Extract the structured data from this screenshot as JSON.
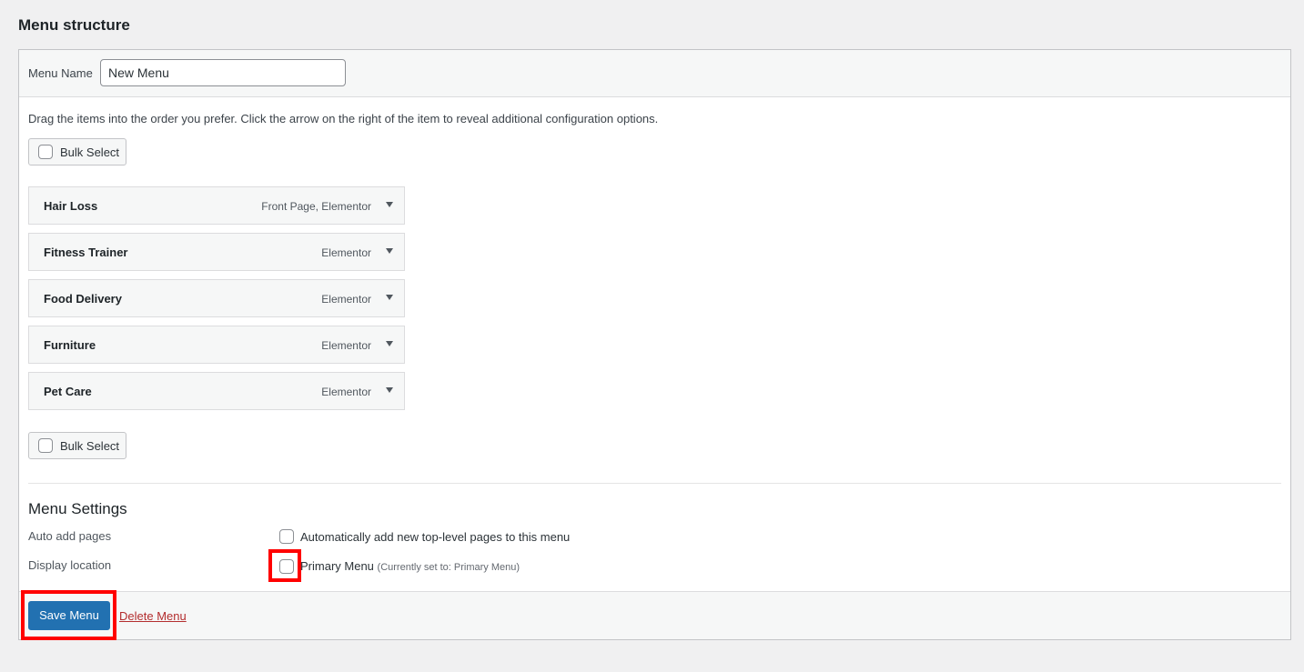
{
  "page": {
    "heading": "Menu structure"
  },
  "menu_name": {
    "label": "Menu Name",
    "value": "New Menu"
  },
  "instructions": "Drag the items into the order you prefer. Click the arrow on the right of the item to reveal additional configuration options.",
  "bulk_select": {
    "label": "Bulk Select"
  },
  "menu_items": [
    {
      "title": "Hair Loss",
      "type": "Front Page, Elementor"
    },
    {
      "title": "Fitness Trainer",
      "type": "Elementor"
    },
    {
      "title": "Food Delivery",
      "type": "Elementor"
    },
    {
      "title": "Furniture",
      "type": "Elementor"
    },
    {
      "title": "Pet Care",
      "type": "Elementor"
    }
  ],
  "settings": {
    "title": "Menu Settings",
    "auto_add": {
      "label": "Auto add pages",
      "option": "Automatically add new top-level pages to this menu"
    },
    "display_location": {
      "label": "Display location",
      "option": "Primary Menu",
      "note": "(Currently set to: Primary Menu)"
    }
  },
  "footer": {
    "save_label": "Save Menu",
    "delete_label": "Delete Menu"
  },
  "colors": {
    "primary": "#2271b1",
    "danger": "#b32d2e",
    "highlight": "#ff0000"
  },
  "icons": {
    "item_toggle": "chevron-down-icon"
  }
}
